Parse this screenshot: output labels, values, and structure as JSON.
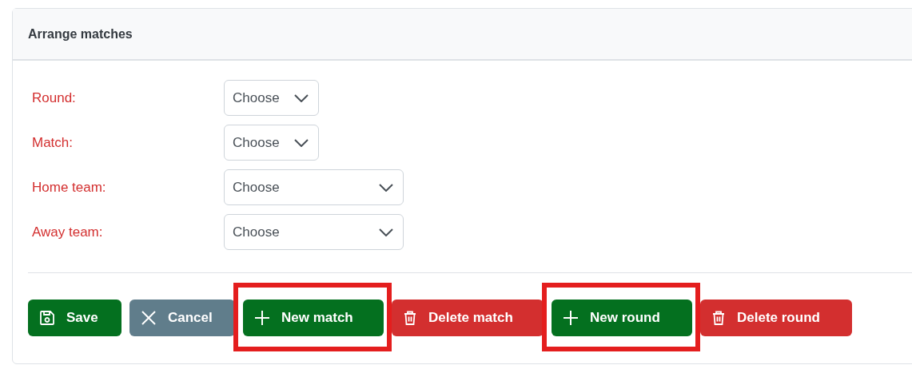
{
  "panel": {
    "title": "Arrange matches"
  },
  "fields": [
    {
      "label": "Round:",
      "value": "Choose"
    },
    {
      "label": "Match:",
      "value": "Choose"
    },
    {
      "label": "Home team:",
      "value": "Choose"
    },
    {
      "label": "Away team:",
      "value": "Choose"
    }
  ],
  "buttons": [
    {
      "label": "Save",
      "kind": "save",
      "highlighted": false
    },
    {
      "label": "Cancel",
      "kind": "cancel",
      "highlighted": false
    },
    {
      "label": "New match",
      "kind": "add",
      "highlighted": true
    },
    {
      "label": "Delete match",
      "kind": "delete",
      "highlighted": false
    },
    {
      "label": "New round",
      "kind": "add",
      "highlighted": true
    },
    {
      "label": "Delete round",
      "kind": "delete",
      "highlighted": false
    }
  ]
}
